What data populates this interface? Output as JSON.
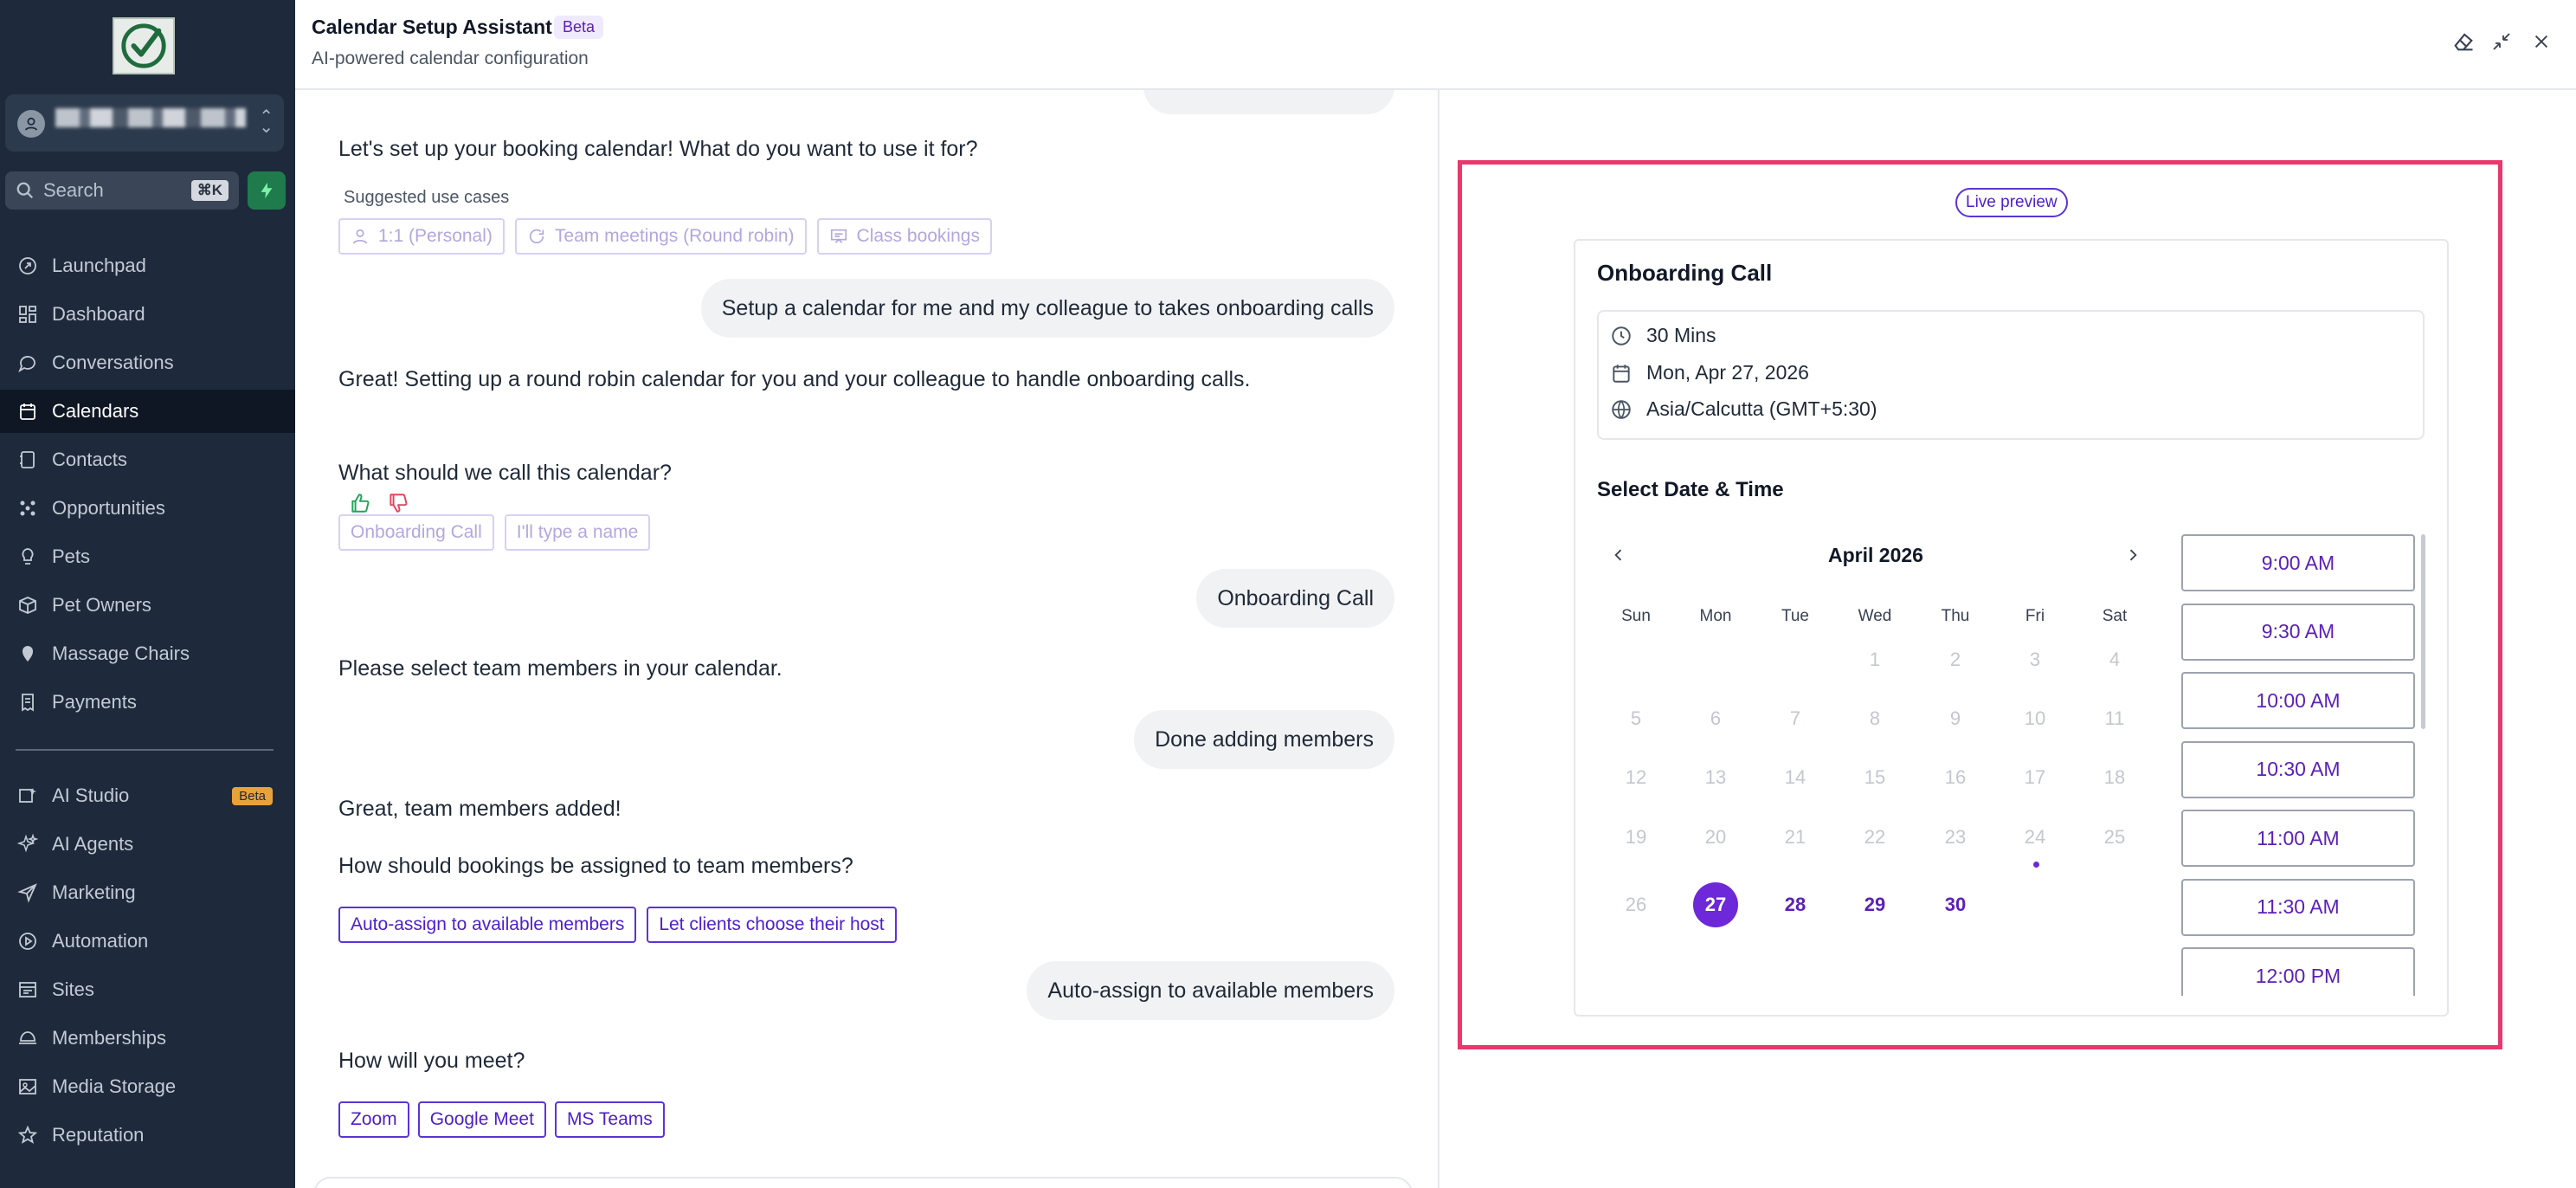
{
  "sidebar": {
    "search_placeholder": "Search",
    "search_shortcut": "⌘K",
    "items": [
      {
        "label": "Launchpad",
        "icon": "launchpad-icon"
      },
      {
        "label": "Dashboard",
        "icon": "dashboard-icon"
      },
      {
        "label": "Conversations",
        "icon": "chat-bubble-icon"
      },
      {
        "label": "Calendars",
        "icon": "calendar-icon",
        "active": true
      },
      {
        "label": "Contacts",
        "icon": "contacts-icon"
      },
      {
        "label": "Opportunities",
        "icon": "opportunities-icon"
      },
      {
        "label": "Pets",
        "icon": "bulb-icon"
      },
      {
        "label": "Pet Owners",
        "icon": "box-icon"
      },
      {
        "label": "Massage Chairs",
        "icon": "pin-icon"
      },
      {
        "label": "Payments",
        "icon": "receipt-icon"
      }
    ],
    "items2": [
      {
        "label": "AI Studio",
        "icon": "ai-studio-icon",
        "badge": "Beta"
      },
      {
        "label": "AI Agents",
        "icon": "sparkle-icon"
      },
      {
        "label": "Marketing",
        "icon": "send-icon"
      },
      {
        "label": "Automation",
        "icon": "automation-icon"
      },
      {
        "label": "Sites",
        "icon": "sites-icon"
      },
      {
        "label": "Memberships",
        "icon": "membership-icon"
      },
      {
        "label": "Media Storage",
        "icon": "image-icon"
      },
      {
        "label": "Reputation",
        "icon": "star-icon"
      }
    ]
  },
  "header": {
    "title": "Calendar Setup Assistant",
    "badge": "Beta",
    "subtitle": "AI-powered calendar configuration"
  },
  "chat": {
    "msg1": "Let's set up your booking calendar! What do you want to use it for?",
    "suggested_label": "Suggested use cases",
    "use_cases": [
      "1:1 (Personal)",
      "Team meetings (Round robin)",
      "Class bookings"
    ],
    "user1": "Setup a calendar for me and my colleague to takes onboarding calls",
    "msg2": "Great! Setting up a round robin calendar for you and your colleague to handle onboarding calls.",
    "msg3": "What should we call this calendar?",
    "name_options": [
      "Onboarding Call",
      "I'll type a name"
    ],
    "user2": "Onboarding Call",
    "msg4": "Please select team members in your calendar.",
    "user3": "Done adding members",
    "msg5": "Great, team members added!",
    "msg6": "How should bookings be assigned to team members?",
    "assign_options": [
      "Auto-assign to available members",
      "Let clients choose their host"
    ],
    "user4": "Auto-assign to available members",
    "msg7": "How will you meet?",
    "meet_options": [
      "Zoom",
      "Google Meet",
      "MS Teams"
    ]
  },
  "preview": {
    "badge": "Live preview",
    "title": "Onboarding Call",
    "duration": "30 Mins",
    "date": "Mon, Apr 27, 2026",
    "timezone": "Asia/Calcutta (GMT+5:30)",
    "select_title": "Select Date & Time",
    "month": "April 2026",
    "weekdays": [
      "Sun",
      "Mon",
      "Tue",
      "Wed",
      "Thu",
      "Fri",
      "Sat"
    ],
    "days": [
      "1",
      "2",
      "3",
      "4",
      "5",
      "6",
      "7",
      "8",
      "9",
      "10",
      "11",
      "12",
      "13",
      "14",
      "15",
      "16",
      "17",
      "18",
      "19",
      "20",
      "21",
      "22",
      "23",
      "24",
      "25",
      "26",
      "27",
      "28",
      "29",
      "30"
    ],
    "selected_day": "27",
    "today_day": "24",
    "available_days": [
      "27",
      "28",
      "29",
      "30"
    ],
    "slots": [
      "9:00 AM",
      "9:30 AM",
      "10:00 AM",
      "10:30 AM",
      "11:00 AM",
      "11:30 AM",
      "12:00 PM"
    ]
  },
  "colors": {
    "sidebar_bg": "#1e2a3b",
    "accent": "#6d28d9",
    "highlight_border": "#e8386d"
  }
}
